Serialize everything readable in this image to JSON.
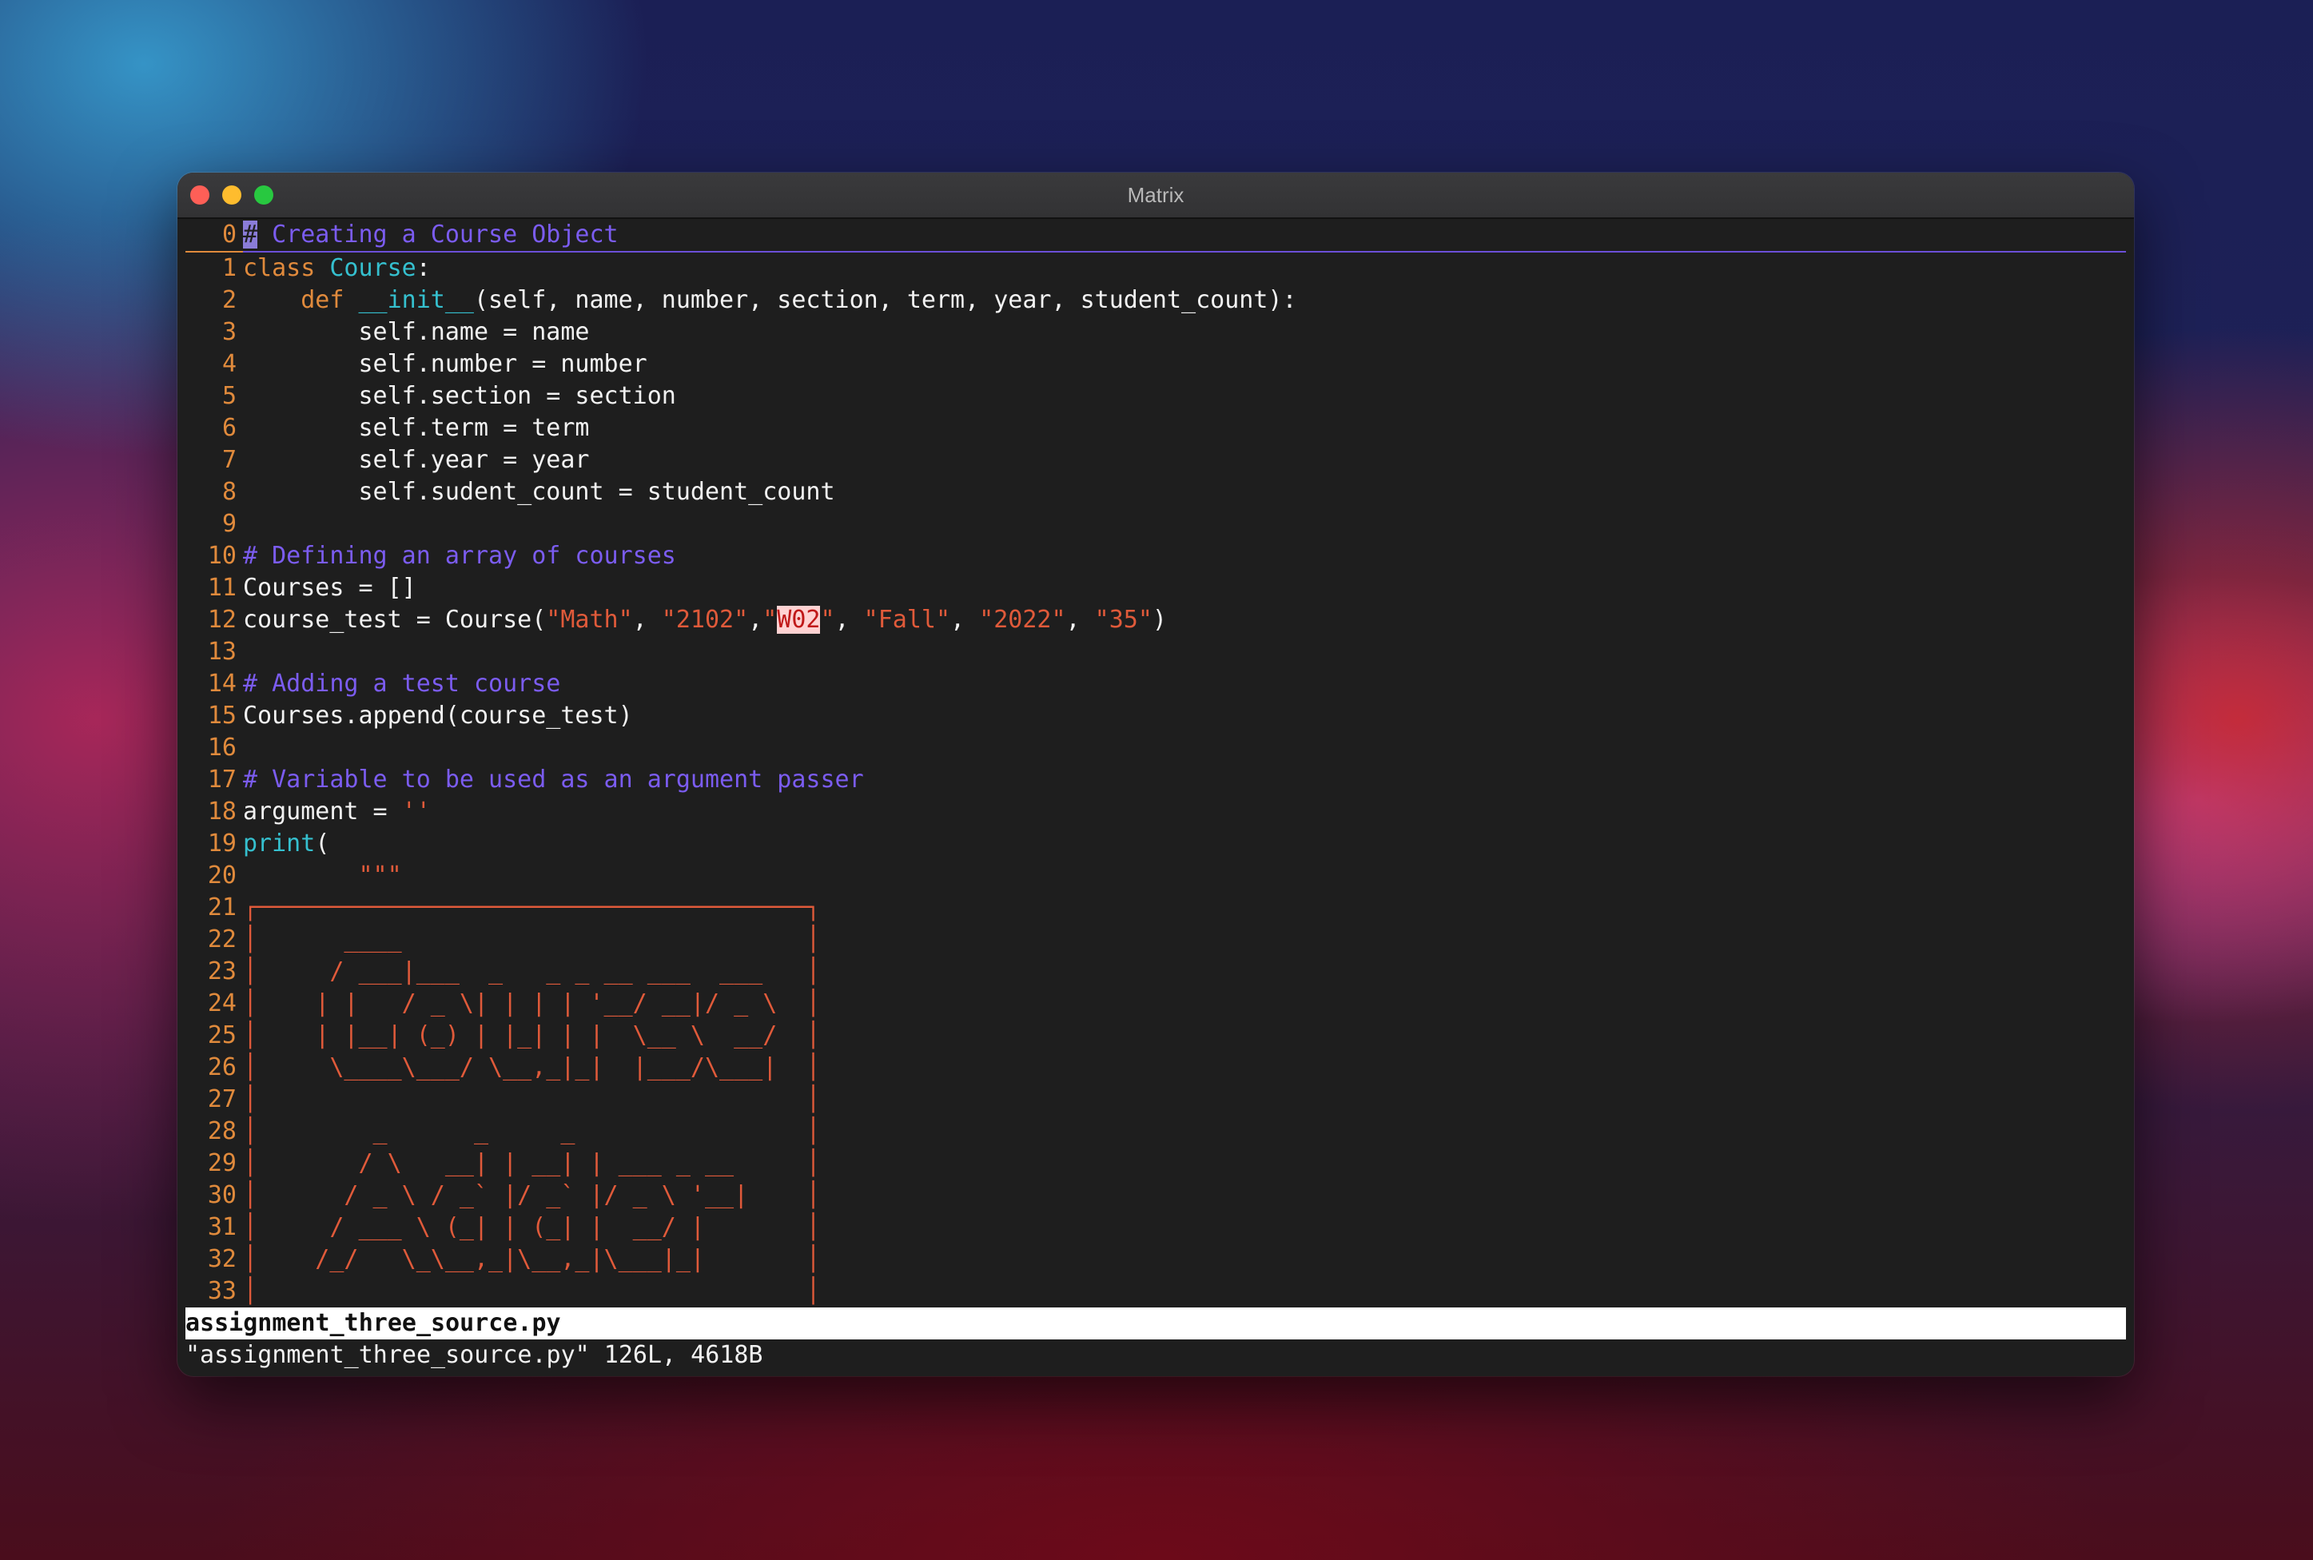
{
  "window": {
    "title": "Matrix"
  },
  "lines": [
    {
      "n": "0",
      "segments": [
        {
          "t": "#",
          "c": "cursor"
        },
        {
          "t": " Creating a Course Object",
          "c": "cmt"
        }
      ]
    },
    {
      "n": "1",
      "segments": [
        {
          "t": "class ",
          "c": "kw"
        },
        {
          "t": "Course",
          "c": "cls"
        },
        {
          "t": ":",
          "c": ""
        }
      ]
    },
    {
      "n": "2",
      "segments": [
        {
          "t": "    ",
          "c": ""
        },
        {
          "t": "def ",
          "c": "kw"
        },
        {
          "t": "__init__",
          "c": "cls"
        },
        {
          "t": "(self, name, number, section, term, year, student_count):",
          "c": ""
        }
      ]
    },
    {
      "n": "3",
      "segments": [
        {
          "t": "        self.name = name",
          "c": ""
        }
      ]
    },
    {
      "n": "4",
      "segments": [
        {
          "t": "        self.number = number",
          "c": ""
        }
      ]
    },
    {
      "n": "5",
      "segments": [
        {
          "t": "        self.section = section",
          "c": ""
        }
      ]
    },
    {
      "n": "6",
      "segments": [
        {
          "t": "        self.term = term",
          "c": ""
        }
      ]
    },
    {
      "n": "7",
      "segments": [
        {
          "t": "        self.year = year",
          "c": ""
        }
      ]
    },
    {
      "n": "8",
      "segments": [
        {
          "t": "        self.sudent_count = student_count",
          "c": ""
        }
      ]
    },
    {
      "n": "9",
      "segments": []
    },
    {
      "n": "10",
      "segments": [
        {
          "t": "# Defining an array of courses",
          "c": "cmt"
        }
      ]
    },
    {
      "n": "11",
      "segments": [
        {
          "t": "Courses = []",
          "c": ""
        }
      ]
    },
    {
      "n": "12",
      "segments": [
        {
          "t": "course_test = Course(",
          "c": ""
        },
        {
          "t": "\"Math\"",
          "c": "str"
        },
        {
          "t": ", ",
          "c": ""
        },
        {
          "t": "\"2102\"",
          "c": "str"
        },
        {
          "t": ",",
          "c": ""
        },
        {
          "t": "\"",
          "c": "str"
        },
        {
          "t": "W02",
          "c": "hl"
        },
        {
          "t": "\"",
          "c": "str"
        },
        {
          "t": ", ",
          "c": ""
        },
        {
          "t": "\"Fall\"",
          "c": "str"
        },
        {
          "t": ", ",
          "c": ""
        },
        {
          "t": "\"2022\"",
          "c": "str"
        },
        {
          "t": ", ",
          "c": ""
        },
        {
          "t": "\"35\"",
          "c": "str"
        },
        {
          "t": ")",
          "c": ""
        }
      ]
    },
    {
      "n": "13",
      "segments": []
    },
    {
      "n": "14",
      "segments": [
        {
          "t": "# Adding a test course",
          "c": "cmt"
        }
      ]
    },
    {
      "n": "15",
      "segments": [
        {
          "t": "Courses.append(course_test)",
          "c": ""
        }
      ]
    },
    {
      "n": "16",
      "segments": []
    },
    {
      "n": "17",
      "segments": [
        {
          "t": "# Variable to be used as an argument passer",
          "c": "cmt"
        }
      ]
    },
    {
      "n": "18",
      "segments": [
        {
          "t": "argument = ",
          "c": ""
        },
        {
          "t": "''",
          "c": "str"
        }
      ]
    },
    {
      "n": "19",
      "segments": [
        {
          "t": "print",
          "c": "cls"
        },
        {
          "t": "(",
          "c": ""
        }
      ]
    },
    {
      "n": "20",
      "segments": [
        {
          "t": "        \"\"\"",
          "c": "str"
        }
      ]
    },
    {
      "n": "21",
      "segments": [
        {
          "t": "┌──────────────────────────────────────┐",
          "c": "art"
        }
      ]
    },
    {
      "n": "22",
      "segments": [
        {
          "t": "│      ____                            │",
          "c": "art"
        }
      ]
    },
    {
      "n": "23",
      "segments": [
        {
          "t": "│     / ___|___  _   _ _ __ ___  ___   │",
          "c": "art"
        }
      ]
    },
    {
      "n": "24",
      "segments": [
        {
          "t": "│    | |   / _ \\| | | | '__/ __|/ _ \\  │",
          "c": "art"
        }
      ]
    },
    {
      "n": "25",
      "segments": [
        {
          "t": "│    | |__| (_) | |_| | |  \\__ \\  __/  │",
          "c": "art"
        }
      ]
    },
    {
      "n": "26",
      "segments": [
        {
          "t": "│     \\____\\___/ \\__,_|_|  |___/\\___|  │",
          "c": "art"
        }
      ]
    },
    {
      "n": "27",
      "segments": [
        {
          "t": "│                                      │",
          "c": "art"
        }
      ]
    },
    {
      "n": "28",
      "segments": [
        {
          "t": "│        _      _     _                │",
          "c": "art"
        }
      ]
    },
    {
      "n": "29",
      "segments": [
        {
          "t": "│       / \\   __| | __| | ___ _ __     │",
          "c": "art"
        }
      ]
    },
    {
      "n": "30",
      "segments": [
        {
          "t": "│      / _ \\ / _` |/ _` |/ _ \\ '__|    │",
          "c": "art"
        }
      ]
    },
    {
      "n": "31",
      "segments": [
        {
          "t": "│     / ___ \\ (_| | (_| |  __/ |       │",
          "c": "art"
        }
      ]
    },
    {
      "n": "32",
      "segments": [
        {
          "t": "│    /_/   \\_\\__,_|\\__,_|\\___|_|       │",
          "c": "art"
        }
      ]
    },
    {
      "n": "33",
      "segments": [
        {
          "t": "│                                      │",
          "c": "art"
        }
      ]
    }
  ],
  "statusline": {
    "filename": "assignment_three_source.py"
  },
  "cmdline": {
    "message": "\"assignment_three_source.py\" 126L, 4618B"
  }
}
